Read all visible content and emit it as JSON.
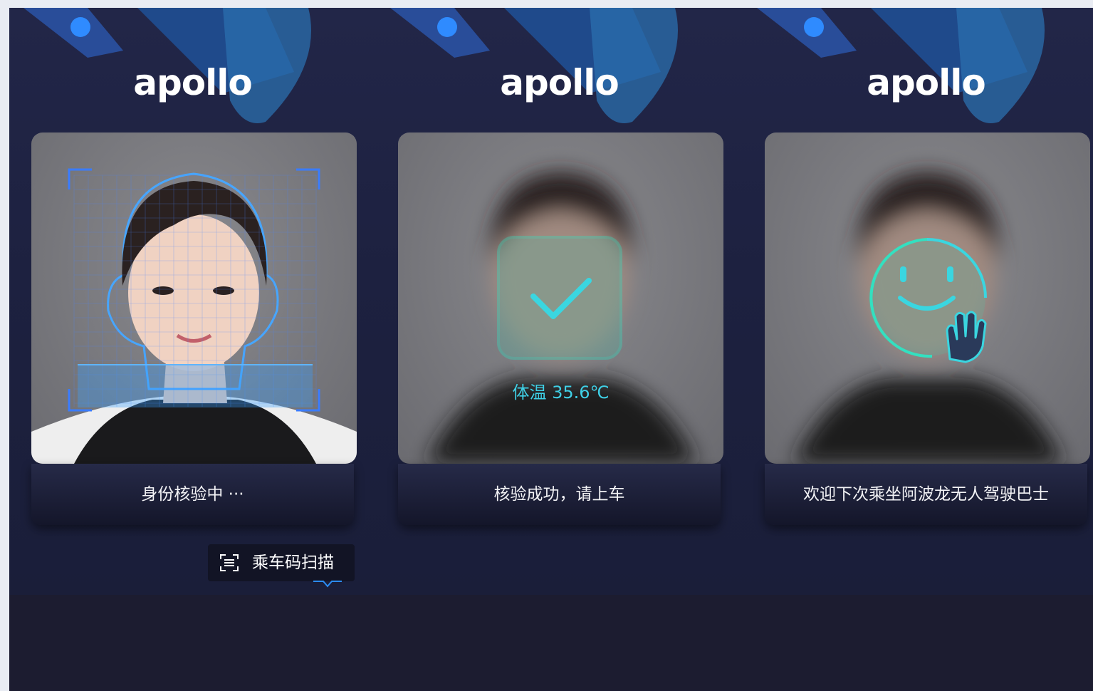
{
  "brand": {
    "logo_text": "apollo"
  },
  "panels": [
    {
      "id": "identity-check",
      "status_text": "身份核验中 ···",
      "scan_button": {
        "label": "乘车码扫描",
        "icon": "qr-scan-icon"
      }
    },
    {
      "id": "verify-success",
      "temperature": "体温 35.6℃",
      "status_text": "核验成功，请上车",
      "icon": "check-icon"
    },
    {
      "id": "farewell",
      "status_text": "欢迎下次乘坐阿波龙无人驾驶巴士",
      "icon": "smile-wave-icon"
    }
  ],
  "colors": {
    "accent_cyan": "#3fd0e6",
    "scan_blue": "#2b8cf2",
    "panel_bg": "#1f2342",
    "check_green": "#33e0c0"
  }
}
